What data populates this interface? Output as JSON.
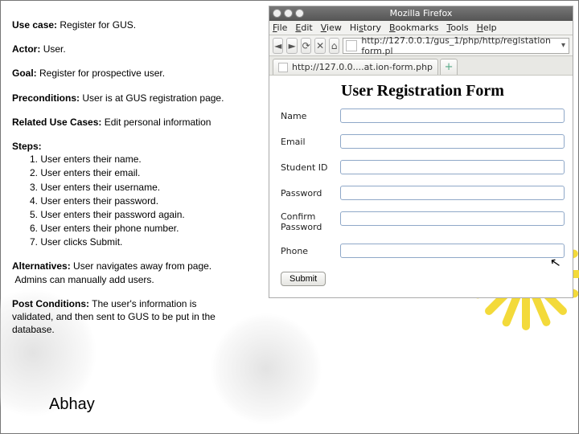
{
  "usecase": {
    "usecase_label": "Use case:",
    "usecase_value": "Register for GUS.",
    "actor_label": "Actor:",
    "actor_value": "User.",
    "goal_label": "Goal:",
    "goal_value": "Register for prospective user.",
    "preconditions_label": "Preconditions:",
    "preconditions_value": "User is at GUS registration page.",
    "related_label": "Related Use Cases:",
    "related_value": "Edit personal information",
    "steps_label": "Steps:",
    "steps": [
      "1. User enters their name.",
      "2. User enters their email.",
      "3. User enters their username.",
      "4. User enters their password.",
      "5. User enters their password again.",
      "6. User enters their phone number.",
      "7. User clicks Submit."
    ],
    "alternatives_label": "Alternatives:",
    "alternatives_value": "User navigates away from page.",
    "alternatives_line2": "Admins can manually add users.",
    "post_label": "Post Conditions:",
    "post_value": "The user's information is validated, and then sent to GUS to be put in the database."
  },
  "author": "Abhay",
  "browser": {
    "window_title": "Mozilla Firefox",
    "menu": {
      "file": "File",
      "edit": "Edit",
      "view": "View",
      "history": "History",
      "bookmarks": "Bookmarks",
      "tools": "Tools",
      "help": "Help"
    },
    "url": "http://127.0.0.1/gus_1/php/http/registation form.pl",
    "tab_label": "http://127.0.0....at.ion-form.php",
    "nav": {
      "back": "◄",
      "fwd": "►",
      "reload": "⟳",
      "stop": "✕",
      "home": "⌂"
    }
  },
  "form": {
    "title": "User Registration Form",
    "fields": {
      "name": "Name",
      "email": "Email",
      "studentid": "Student ID",
      "password": "Password",
      "confirm_l1": "Confirm",
      "confirm_l2": "Password",
      "phone": "Phone"
    },
    "submit_label": "Submit"
  }
}
